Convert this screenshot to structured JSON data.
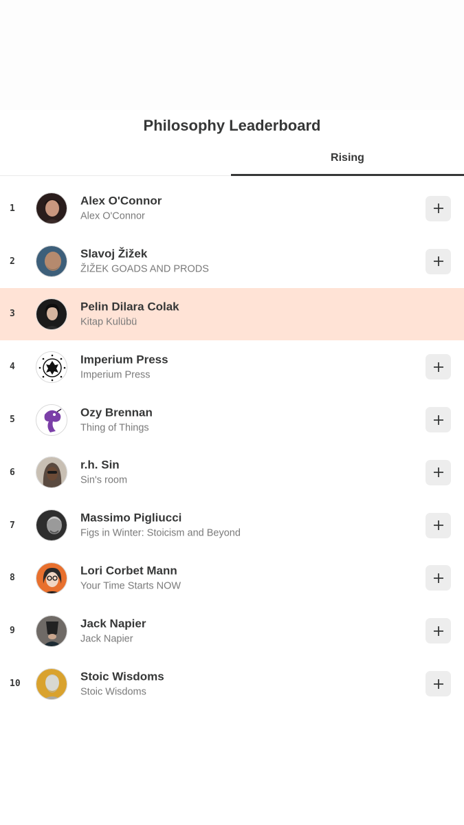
{
  "title": "Philosophy Leaderboard",
  "tabs": [
    {
      "label": "",
      "active": false
    },
    {
      "label": "Rising",
      "active": true
    }
  ],
  "colors": {
    "highlight": "#ffe3d6",
    "text": "#363737",
    "subtext": "#7a7a7a",
    "button_bg": "#ededed"
  },
  "rows": [
    {
      "rank": "1",
      "name": "Alex O'Connor",
      "publication": "Alex O'Connor",
      "avatar_icon": "portrait-dark-hair-icon",
      "add_button": true
    },
    {
      "rank": "2",
      "name": "Slavoj Žižek",
      "publication": "ŽIŽEK GOADS AND PRODS",
      "avatar_icon": "portrait-bearded-man-icon",
      "add_button": true
    },
    {
      "rank": "3",
      "name": "Pelin Dilara Colak",
      "publication": "Kitap Kulübü",
      "avatar_icon": "portrait-woman-icon",
      "add_button": false,
      "highlighted": true
    },
    {
      "rank": "4",
      "name": "Imperium Press",
      "publication": "Imperium Press",
      "avatar_icon": "eagle-emblem-icon",
      "add_button": true
    },
    {
      "rank": "5",
      "name": "Ozy Brennan",
      "publication": "Thing of Things",
      "avatar_icon": "purple-creature-icon",
      "add_button": true
    },
    {
      "rank": "6",
      "name": "r.h. Sin",
      "publication": "Sin's room",
      "avatar_icon": "portrait-hooded-man-icon",
      "add_button": true
    },
    {
      "rank": "7",
      "name": "Massimo Pigliucci",
      "publication": "Figs in Winter: Stoicism and Beyond",
      "avatar_icon": "portrait-bw-man-icon",
      "add_button": true
    },
    {
      "rank": "8",
      "name": "Lori Corbet Mann",
      "publication": "Your Time Starts NOW",
      "avatar_icon": "portrait-woman-glasses-icon",
      "add_button": true
    },
    {
      "rank": "9",
      "name": "Jack Napier",
      "publication": "Jack Napier",
      "avatar_icon": "portrait-masked-figure-icon",
      "add_button": true
    },
    {
      "rank": "10",
      "name": "Stoic Wisdoms",
      "publication": "Stoic Wisdoms",
      "avatar_icon": "marble-bust-icon",
      "add_button": true
    }
  ]
}
